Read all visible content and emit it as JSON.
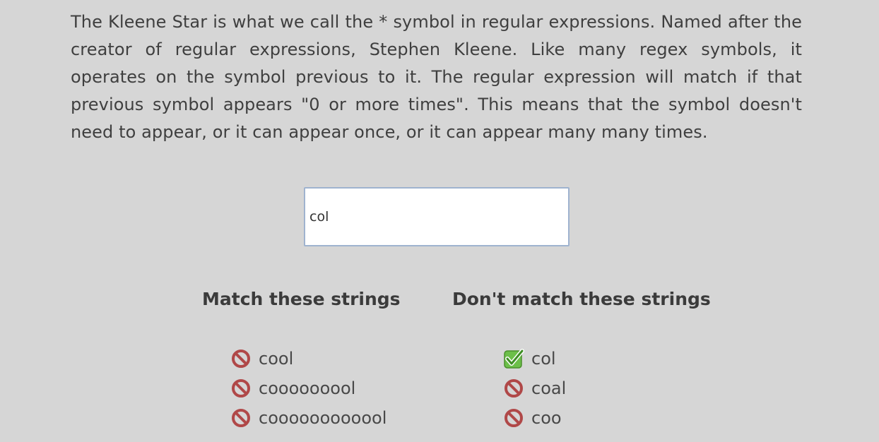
{
  "description": "The Kleene Star is what we call the * symbol in regular expressions. Named after the creator of regular expressions, Stephen Kleene. Like many regex symbols, it operates on the symbol previous to it. The regular expression will match if that previous symbol appears \"0 or more times\". This means that the symbol doesn't need to appear, or it can appear once, or it can appear many many times.",
  "regex_input": {
    "value": "col"
  },
  "match_column": {
    "heading": "Match these strings",
    "items": [
      {
        "text": "cool",
        "status_icon": "no-match-icon"
      },
      {
        "text": "cooooooool",
        "status_icon": "no-match-icon"
      },
      {
        "text": "coooooooooool",
        "status_icon": "no-match-icon"
      }
    ]
  },
  "nomatch_column": {
    "heading": "Don't match these strings",
    "items": [
      {
        "text": "col",
        "status_icon": "checkmark-icon"
      },
      {
        "text": "coal",
        "status_icon": "no-match-icon"
      },
      {
        "text": "coo",
        "status_icon": "no-match-icon"
      }
    ]
  },
  "colors": {
    "background": "#d6d6d6",
    "prohibited_icon": "#b04848",
    "check_icon": "#5aa83a",
    "input_border": "#9fb3cf"
  }
}
